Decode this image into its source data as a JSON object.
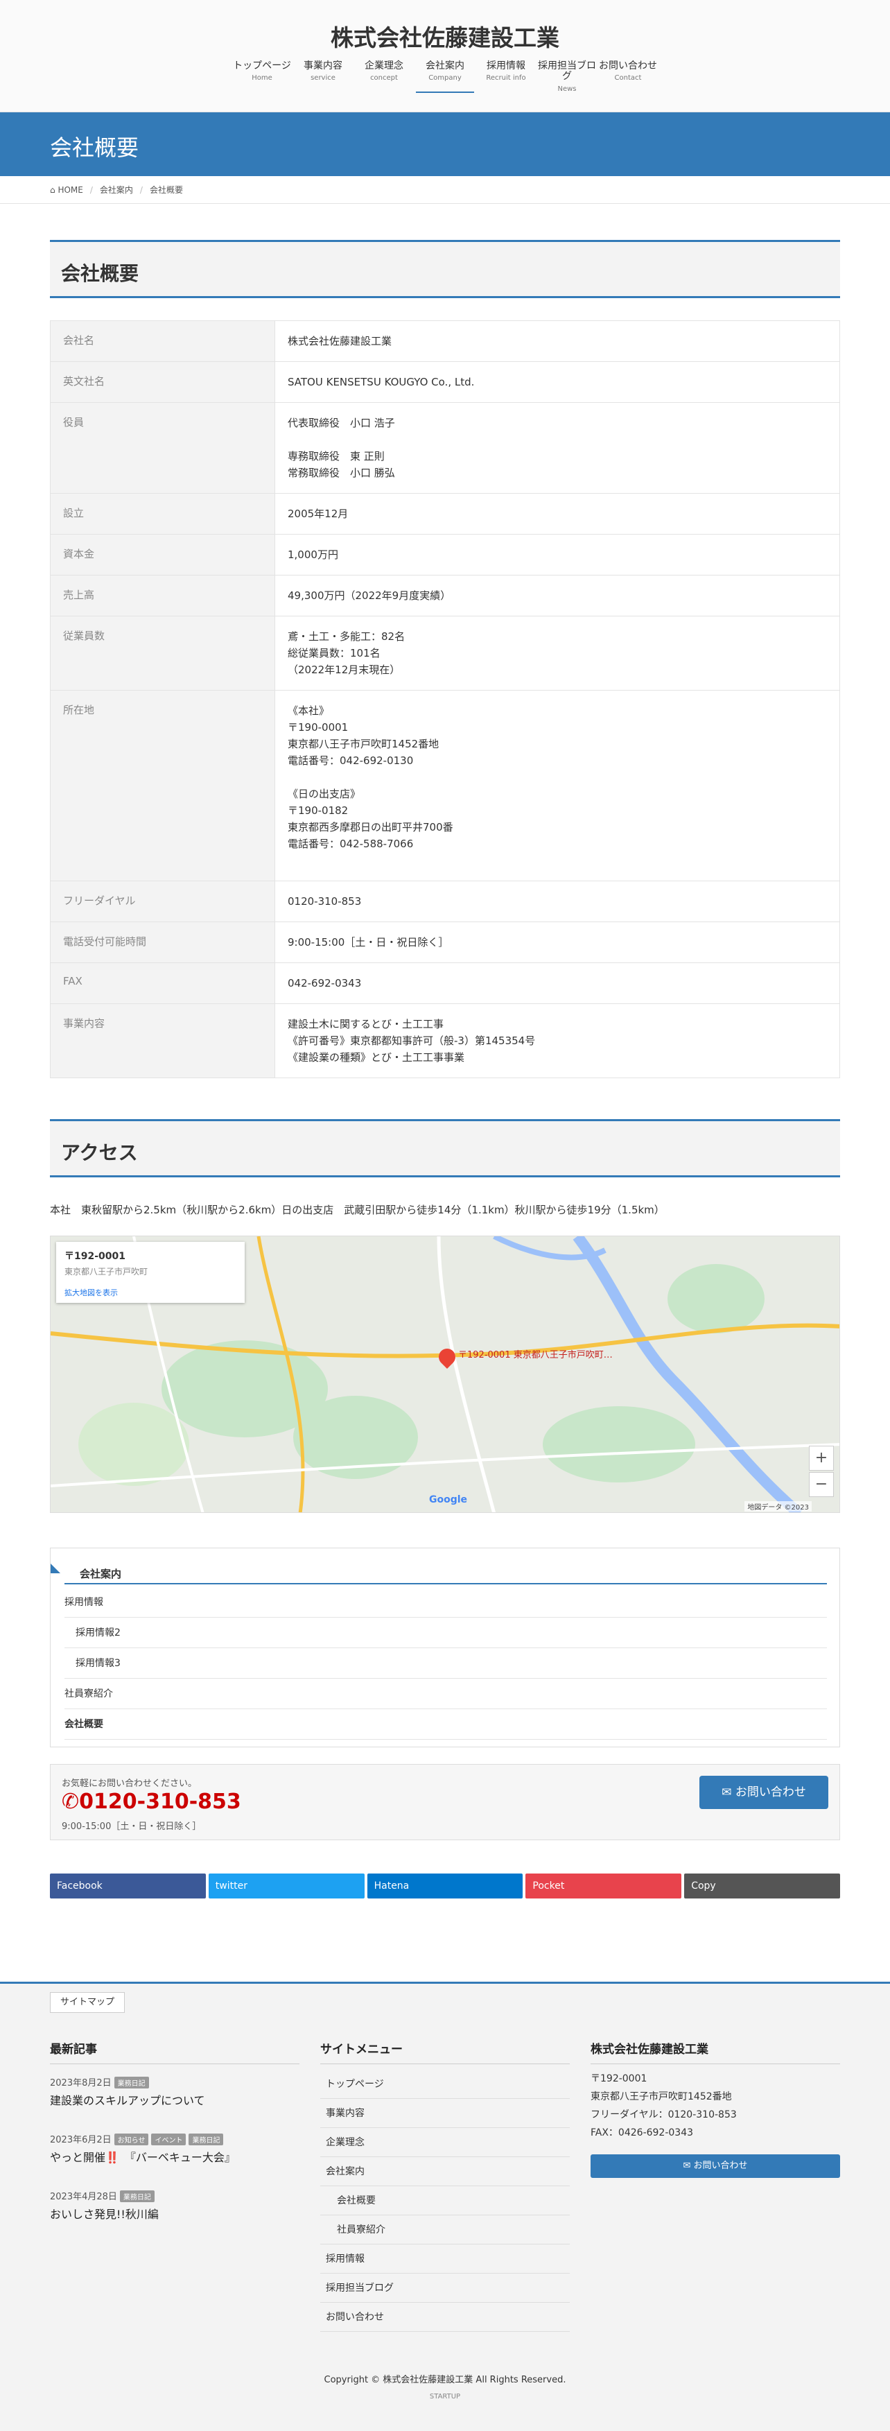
{
  "header": {
    "site_title": "株式会社佐藤建設工業",
    "nav": [
      {
        "ja": "トップページ",
        "en": "Home"
      },
      {
        "ja": "事業内容",
        "en": "service"
      },
      {
        "ja": "企業理念",
        "en": "concept"
      },
      {
        "ja": "会社案内",
        "en": "Company"
      },
      {
        "ja": "採用情報",
        "en": "Recruit info"
      },
      {
        "ja": "採用担当ブログ",
        "en": "News"
      },
      {
        "ja": "お問い合わせ",
        "en": "Contact"
      }
    ]
  },
  "page_header": {
    "title": "会社概要"
  },
  "breadcrumb": {
    "home": "HOME",
    "parent": "会社案内",
    "current": "会社概要"
  },
  "sections": {
    "company": "会社概要",
    "access": "アクセス"
  },
  "company_table": [
    {
      "label": "会社名",
      "value": "株式会社佐藤建設工業"
    },
    {
      "label": "英文社名",
      "value": "SATOU KENSETSU KOUGYO Co., Ltd."
    },
    {
      "label": "役員",
      "value": "代表取締役　小口 浩子\n\n専務取締役　東 正則\n常務取締役　小口 勝弘"
    },
    {
      "label": "設立",
      "value": "2005年12月"
    },
    {
      "label": "資本金",
      "value": "1,000万円"
    },
    {
      "label": "売上高",
      "value": "49,300万円（2022年9月度実績）"
    },
    {
      "label": "従業員数",
      "value": "鳶・土工・多能工：82名\n総従業員数：101名\n（2022年12月末現在）"
    },
    {
      "label": "所在地",
      "value": "《本社》\n〒190-0001\n東京都八王子市戸吹町1452番地\n電話番号：042-692-0130\n\n《日の出支店》\n〒190-0182\n東京都西多摩郡日の出町平井700番\n電話番号：042-588-7066\n\n"
    },
    {
      "label": "フリーダイヤル",
      "value": "0120-310-853"
    },
    {
      "label": "電話受付可能時間",
      "value": "9:00-15:00［土・日・祝日除く］"
    },
    {
      "label": "FAX",
      "value": "042-692-0343"
    },
    {
      "label": "事業内容",
      "value": "建設土木に関するとび・土工工事\n《許可番号》東京都都知事許可（般-3）第145354号\n《建設業の種類》とび・土工工事事業"
    }
  ],
  "access": {
    "text": "本社　東秋留駅から2.5km（秋川駅から2.6km）日の出支店　武蔵引田駅から徒歩14分（1.1km）秋川駅から徒歩19分（1.5km）",
    "map": {
      "card_address": "〒192-0001",
      "card_more": "拡大地図を表示",
      "pin_label": "〒192-0001 東京都八王子市戸吹町…",
      "zoom_in": "+",
      "zoom_out": "−",
      "google": "Google",
      "copyright": "地図データ ©2023"
    }
  },
  "sub_menu": {
    "title": "会社案内",
    "items": [
      "採用情報",
      "採用情報2",
      "採用情報3",
      "社員寮紹介",
      "会社概要"
    ]
  },
  "cta": {
    "message": "お気軽にお問い合わせください。",
    "tel": "0120-310-853",
    "hours": "9:00-15:00［土・日・祝日除く］",
    "button": "お問い合わせ"
  },
  "share": [
    {
      "label": "Facebook",
      "color": "#3b5998"
    },
    {
      "label": "twitter",
      "color": "#1da1f2"
    },
    {
      "label": "Hatena",
      "color": "#0077cc"
    },
    {
      "label": "Pocket",
      "color": "#e8434c"
    },
    {
      "label": "Copy",
      "color": "#555555"
    }
  ],
  "footer": {
    "sitemap_tab": "サイトマップ",
    "recent_title": "最新記事",
    "posts": [
      {
        "date": "2023年8月2日",
        "tags": [
          "業務日記"
        ],
        "title": "建設業のスキルアップについて"
      },
      {
        "date": "2023年6月2日",
        "tags": [
          "お知らせ",
          "イベント",
          "業務日記"
        ],
        "title": "やっと開催‼️　『バーベキュー大会』"
      },
      {
        "date": "2023年4月28日",
        "tags": [
          "業務日記"
        ],
        "title": "おいしさ発見!!秋川編"
      }
    ],
    "menu_title": "サイトメニュー",
    "menu": [
      "トップページ",
      "事業内容",
      "企業理念",
      "会社案内",
      "会社概要",
      "社員寮紹介",
      "採用情報",
      "採用担当ブログ",
      "お問い合わせ"
    ],
    "company_title": "株式会社佐藤建設工業",
    "company_info": "〒192-0001\n東京都八王子市戸吹町1452番地\nフリーダイヤル：0120-310-853\nFAX：0426-692-0343",
    "contact_button": "お問い合わせ",
    "copyright": "Copyright © 株式会社佐藤建設工業 All Rights Reserved.",
    "powered": "STARTUP"
  }
}
